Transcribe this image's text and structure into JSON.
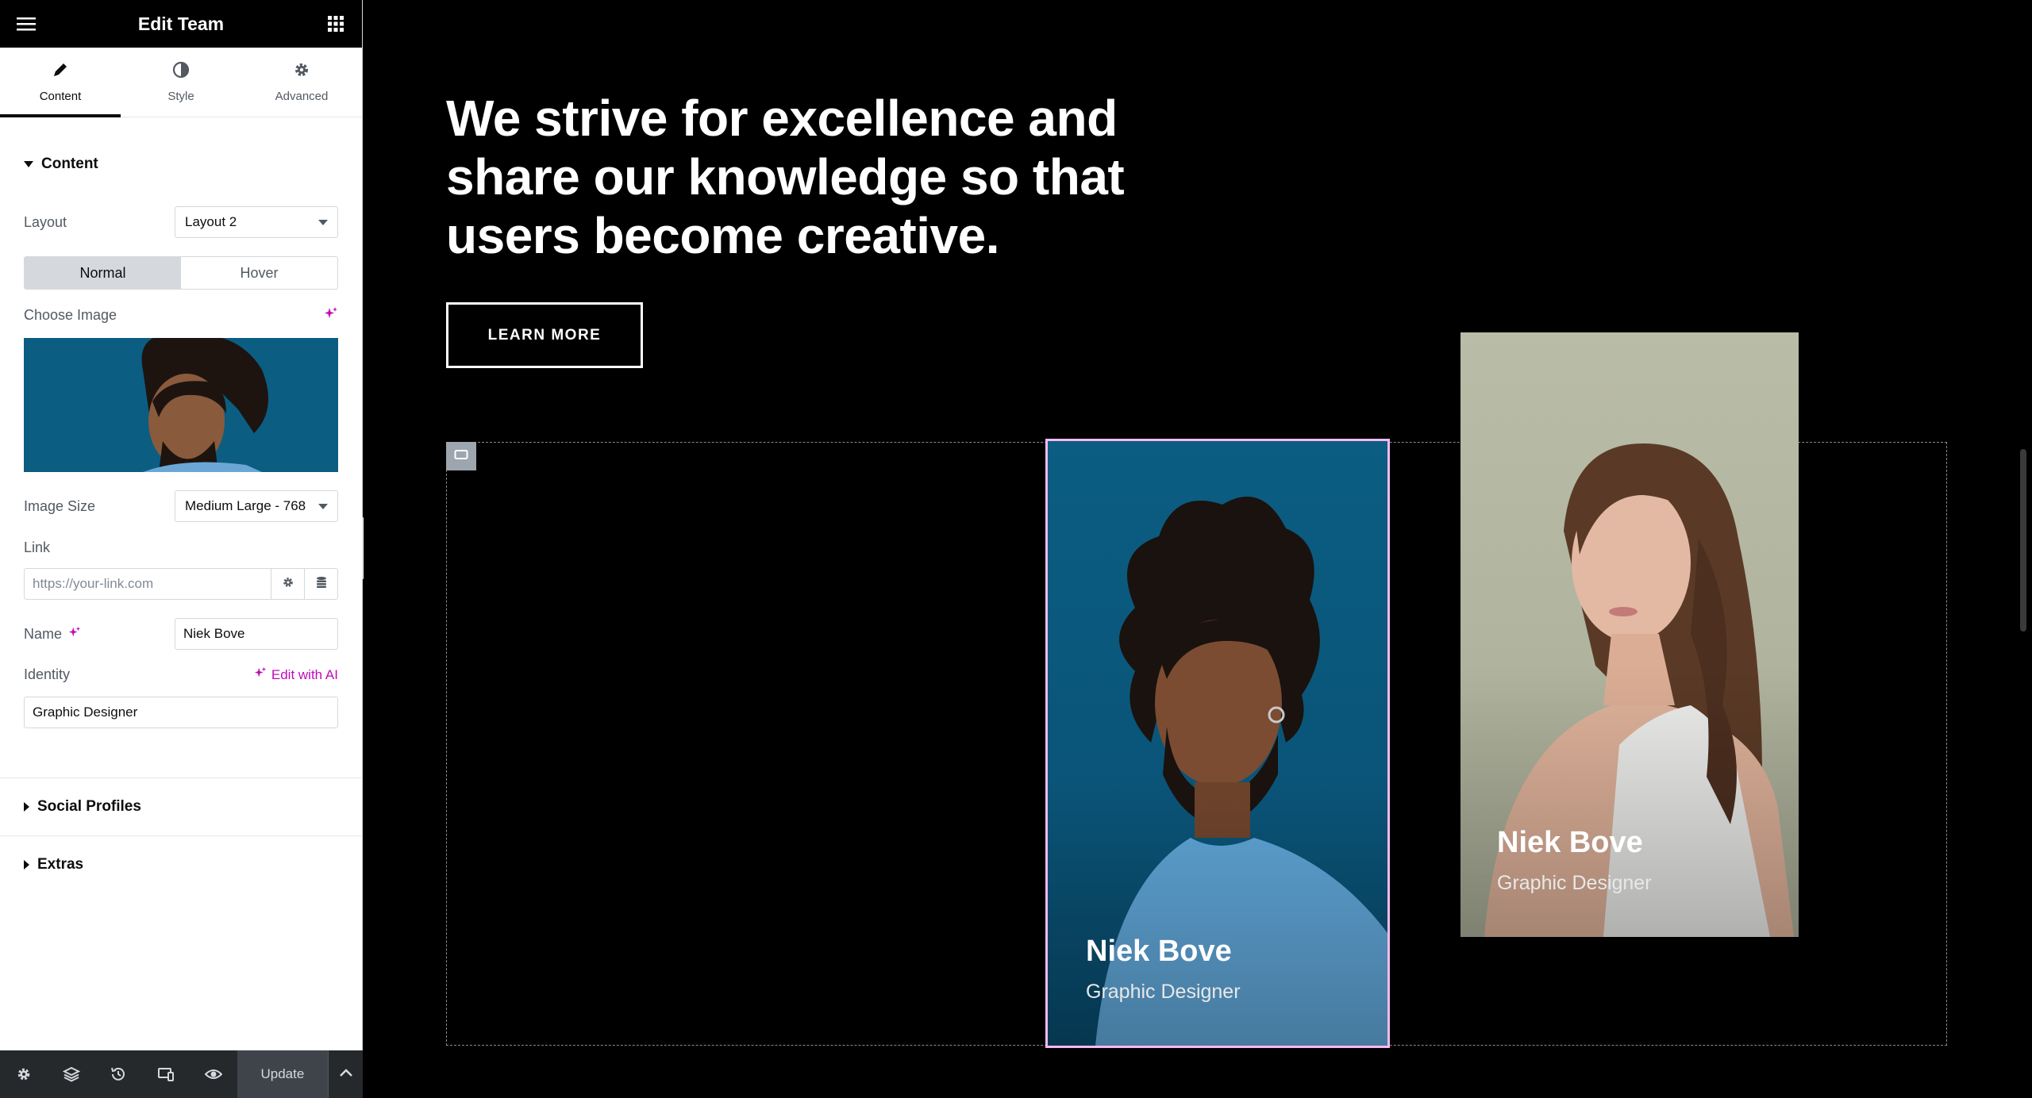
{
  "panel": {
    "title": "Edit Team",
    "tabs": [
      {
        "label": "Content",
        "icon": "pencil-icon"
      },
      {
        "label": "Style",
        "icon": "half-circle-icon"
      },
      {
        "label": "Advanced",
        "icon": "gear-icon"
      }
    ],
    "content_section": {
      "title": "Content",
      "layout_label": "Layout",
      "layout_value": "Layout 2",
      "states": [
        "Normal",
        "Hover"
      ],
      "choose_image_label": "Choose Image",
      "image_size_label": "Image Size",
      "image_size_value": "Medium Large - 768",
      "link_label": "Link",
      "link_placeholder": "https://your-link.com",
      "name_label": "Name",
      "name_value": "Niek Bove",
      "identity_label": "Identity",
      "edit_with_ai": "Edit with AI",
      "identity_value": "Graphic Designer"
    },
    "social_profiles": "Social Profiles",
    "extras": "Extras",
    "footer": {
      "update_label": "Update"
    }
  },
  "canvas": {
    "headline_lines": [
      "We strive for excellence and",
      "share our knowledge so that",
      "users become creative."
    ],
    "button_label": "LEARN MORE",
    "cards": [
      {
        "name": "Niek Bove",
        "role": "Graphic Designer"
      },
      {
        "name": "Niek Bove",
        "role": "Graphic Designer"
      }
    ]
  },
  "colors": {
    "accent_ai": "#c00bb9",
    "card1_bg": "#0b5d82",
    "card2_bg": "#b9bca6",
    "selection_outline": "#f5b9f0"
  }
}
